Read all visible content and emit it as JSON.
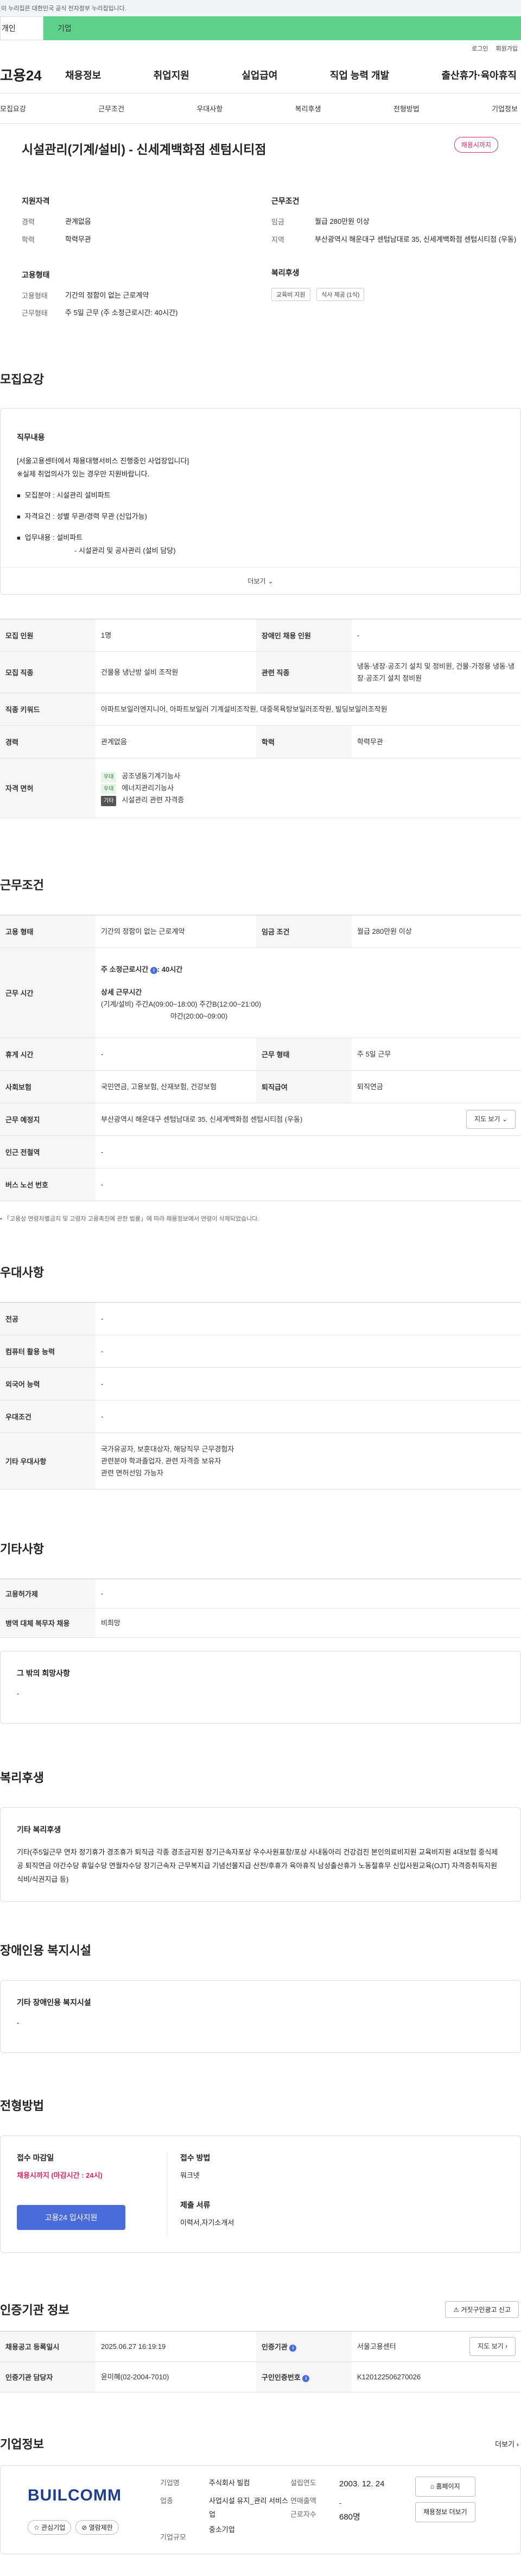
{
  "banner": "이 누리집은 대한민국 공식 전자정부 누리집입니다.",
  "user_tabs": {
    "personal": "개인",
    "company": "기업"
  },
  "util": {
    "login": "로그인",
    "join": "회원가입"
  },
  "gnb": {
    "logo": "고용24",
    "menus": [
      "채용정보",
      "취업지원",
      "실업급여",
      "직업 능력 개발",
      "출산휴가·육아휴직"
    ]
  },
  "subnav": [
    "모집요강",
    "근무조건",
    "우대사항",
    "복리후생",
    "전형방법",
    "기업정보"
  ],
  "job": {
    "title": "시설관리(기계/설비) - 신세계백화점 센텀시티점",
    "status": "채용시까지",
    "qualifications": {
      "label": "지원자격",
      "career_k": "경력",
      "career_v": "관계없음",
      "edu_k": "학력",
      "edu_v": "학력무관"
    },
    "conditions": {
      "label": "근무조건",
      "wage_k": "임금",
      "wage_v": "월급 280만원 이상",
      "region_k": "지역",
      "region_v": "부산광역시 해운대구 센텀남대로 35, 신세계백화점 센텀시티점 (우동)"
    },
    "employment": {
      "label": "고용형태",
      "type_k": "고용형태",
      "type_v": "기간의 정함이 없는 근로계약",
      "hours_k": "근무형태",
      "hours_v": "주 5일 근무 (주 소정근로시간: 40시간)"
    },
    "benefits": {
      "label": "복리후생",
      "chips": [
        "교육비 지원",
        "식사 제공 (1식)"
      ]
    }
  },
  "recruit": {
    "section": "모집요강",
    "box_title": "직무내용",
    "lines": [
      "[서울고용센터에서 채용대행서비스 진행중인 사업장입니다]",
      "※실제 취업의사가 있는 경우만 지원바랍니다."
    ],
    "bullets": [
      "모집분야 : 시설관리 설비파트",
      "자격요건 : 성별 무관/경력 무관 (신입가능)",
      "업무내용 : 설비파트"
    ],
    "sub_line": "- 시설관리 및 공사관리 (설비 담당)",
    "more": "더보기",
    "table": {
      "count_k": "모집 인원",
      "count_v": "1명",
      "disabled_k": "장애인 채용 인원",
      "disabled_v": "-",
      "job_k": "모집 직종",
      "job_v": "건물용 냉난방 설비 조작원",
      "related_k": "관련 직종",
      "related_v": "냉동·냉장·공조기 설치 및 정비원, 건물·가정용 냉동·냉장·공조기 설치 정비원",
      "keyword_k": "직종 키워드",
      "keyword_v": "아파트보일러엔지니어, 아파트보일러 기계설비조작원, 대중목욕탕보일러조작원, 빌딩보일러조작원",
      "career_k": "경력",
      "career_v": "관계없음",
      "edu_k": "학력",
      "edu_v": "학력무관",
      "license_k": "자격 면허",
      "licenses": [
        {
          "tag": "우대",
          "name": "공조냉동기계기능사"
        },
        {
          "tag": "우대",
          "name": "에너지관리기능사"
        },
        {
          "tag": "기타",
          "name": "시설관리 관련 자격증"
        }
      ]
    }
  },
  "work": {
    "section": "근무조건",
    "type_k": "고용 형태",
    "type_v": "기간의 정함이 없는 근로계약",
    "wage_k": "임금 조건",
    "wage_v": "월급 280만원 이상",
    "time_k": "근무 시간",
    "time_main": "주 소정근로시간",
    "time_hours": ": 40시간",
    "time_detail_title": "상세 근무시간",
    "time_detail_1": "(기계/설비) 주간A(09:00~18:00) 주간B(12:00~21:00)",
    "time_detail_2": "야간(20:00~09:00)",
    "rest_k": "휴게 시간",
    "rest_v": "-",
    "form_k": "근무 형태",
    "form_v": "주 5일 근무",
    "insurance_k": "사회보험",
    "insurance_v": "국민연금, 고용보험, 산재보험, 건강보험",
    "pension_k": "퇴직급여",
    "pension_v": "퇴직연금",
    "place_k": "근무 예정지",
    "place_v": "부산광역시 해운대구 센텀남대로 35, 신세계백화점 센텀시티점 (우동)",
    "map_btn": "지도 보기",
    "subway_k": "인근 전철역",
    "subway_v": "-",
    "bus_k": "버스 노선 번호",
    "bus_v": "-",
    "note": "「고용상 연령차별금지 및 고령자 고용촉진에 관한 법률」에 따라 채용정보에서 연령이 삭제되었습니다."
  },
  "pref": {
    "section": "우대사항",
    "rows": [
      {
        "k": "전공",
        "v": "-"
      },
      {
        "k": "컴퓨터 활용 능력",
        "v": "-"
      },
      {
        "k": "외국어 능력",
        "v": "-"
      },
      {
        "k": "우대조건",
        "v": "-"
      }
    ],
    "etc_k": "기타 우대사항",
    "etc_lines": [
      "국가유공자, 보훈대상자, 해당직무 근무경험자",
      "관련분야 학과졸업자, 관련 자격증 보유자",
      "관련 면허선임 가능자"
    ]
  },
  "other": {
    "section": "기타사항",
    "equip_k": "고용허가제",
    "equip_v": "-",
    "mil_k": "병역 대체 복무자 채용",
    "mil_v": "비희망",
    "wish_title": "그 밖의 희망사항",
    "wish_v": "-"
  },
  "welfare": {
    "section": "복리후생",
    "box_title": "기타 복리후생",
    "text": "기타(주5일근무 연차 정기휴가 경조휴가 퇴직금 각종 경조금지원 장기근속자포상 우수사원표창/포상 사내동아리 건강검진 본인의료비지원 교육비지원 4대보험 중식제공 퇴직연금 야간수당 휴일수당 연월차수당 장기근속자 근무복지급 기념선물지급 산전/후휴가 육아휴직 남성출산휴가 노동절휴무 신입사원교육(OJT) 자격증취득지원 식비/식권지급 등)"
  },
  "disabled": {
    "section": "장애인용 복지시설",
    "box_title": "기타 장애인용 복지시설",
    "v": "-"
  },
  "process": {
    "section": "전형방법",
    "deadline_label": "접수 마감일",
    "deadline_v": "채용시까지 (마감시간 : 24시)",
    "method_label": "접수 방법",
    "method_v": "워크넷",
    "docs_label": "제출 서류",
    "docs_v": "이력서,자기소개서",
    "apply_btn": "고용24 입사지원"
  },
  "cert": {
    "section": "인증기관 정보",
    "report_btn": "거짓구인광고 신고",
    "date_k": "채용공고 등록일시",
    "date_v": "2025.06.27 16:19:19",
    "org_k": "인증기관",
    "org_v": "서울고용센터",
    "mgr_k": "인증기관 담당자",
    "mgr_v": "윤미혜(02-2004-7010)",
    "num_k": "구인인증번호",
    "num_v": "K120122506270026",
    "map_btn": "지도 보기"
  },
  "company": {
    "section": "기업정보",
    "more": "더보기",
    "logo": "BUILCOMM",
    "interest_btn": "관심기업",
    "block_btn": "열람제한",
    "name_k": "기업명",
    "name_v": "주식회사 빌컴",
    "est_k": "설립연도",
    "est_v": "2003. 12. 24",
    "biz_k": "업종",
    "biz_v": "사업시설 유지_관리 서비스업",
    "sales_k": "연매출액",
    "sales_v": "-",
    "emp_k": "근로자수",
    "emp_v": "680명",
    "size_k": "기업규모",
    "size_v": "중소기업",
    "home_btn": "홈페이지",
    "list_btn": "채용정보 더보기"
  },
  "colors": {
    "accent_green": "#5fd18c",
    "primary_blue": "#4a6cdb",
    "status_pink": "#e0245e"
  }
}
